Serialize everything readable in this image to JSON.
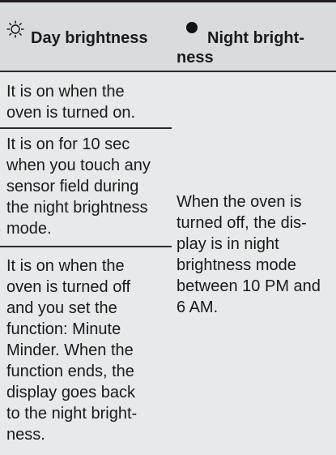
{
  "table": {
    "headers": {
      "day": {
        "icon": "sun-outline-icon",
        "label": "Day brightness"
      },
      "night": {
        "icon": "filled-circle-icon",
        "label_line1": "Night bright-",
        "label_line2": "ness"
      }
    },
    "day_rows": [
      {
        "lines": [
          "It is on when the",
          "oven is turned on."
        ]
      },
      {
        "lines": [
          "It is on for 10 sec",
          "when you touch any",
          "sensor field during",
          "the night brightness",
          "mode."
        ]
      },
      {
        "lines": [
          "It is on when the",
          "oven is turned off",
          "and you set the",
          "function: Minute",
          "Minder. When the",
          "function ends, the",
          "display goes back",
          "to the night bright-",
          "ness."
        ]
      }
    ],
    "night_cell": {
      "lines": [
        "When the oven is",
        "turned off, the dis-",
        "play is in night",
        "brightness mode",
        "between 10 PM and",
        "6 AM."
      ]
    }
  }
}
